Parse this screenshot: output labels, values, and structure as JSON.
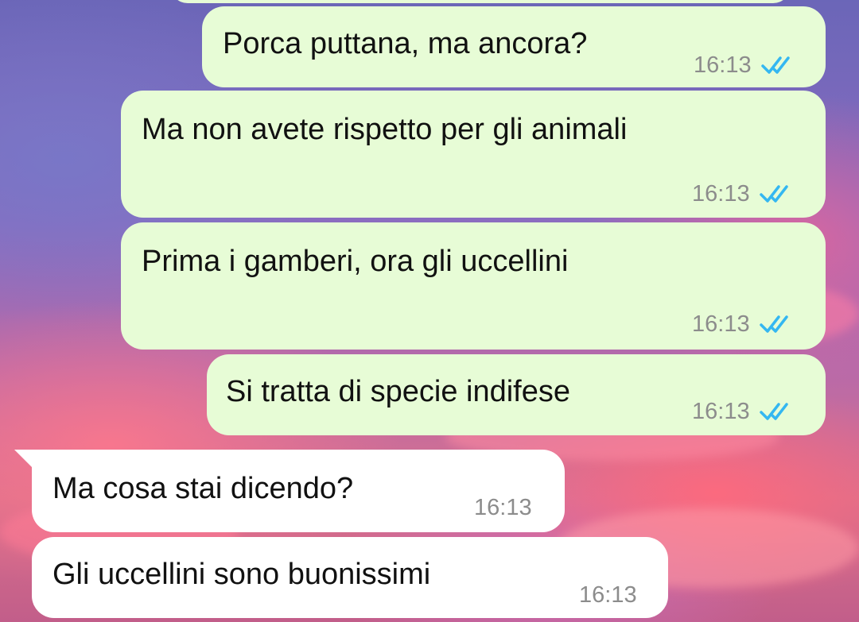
{
  "colors": {
    "outgoing_bubble": "#e7fcd6",
    "incoming_bubble": "#ffffff",
    "read_ticks": "#34b7f1",
    "timestamp": "#8c8c8c"
  },
  "messages": [
    {
      "direction": "outgoing",
      "text": "Porca puttana, ma ancora?",
      "time": "16:13",
      "status_icon": "double-check-read-icon"
    },
    {
      "direction": "outgoing",
      "text": "Ma non avete rispetto per gli animali",
      "time": "16:13",
      "status_icon": "double-check-read-icon"
    },
    {
      "direction": "outgoing",
      "text": "Prima i gamberi, ora gli uccellini",
      "time": "16:13",
      "status_icon": "double-check-read-icon"
    },
    {
      "direction": "outgoing",
      "text": "Si tratta di specie indifese",
      "time": "16:13",
      "status_icon": "double-check-read-icon"
    },
    {
      "direction": "incoming",
      "text": "Ma cosa stai dicendo?",
      "time": "16:13"
    },
    {
      "direction": "incoming",
      "text": "Gli uccellini sono buonissimi",
      "time": "16:13"
    }
  ]
}
